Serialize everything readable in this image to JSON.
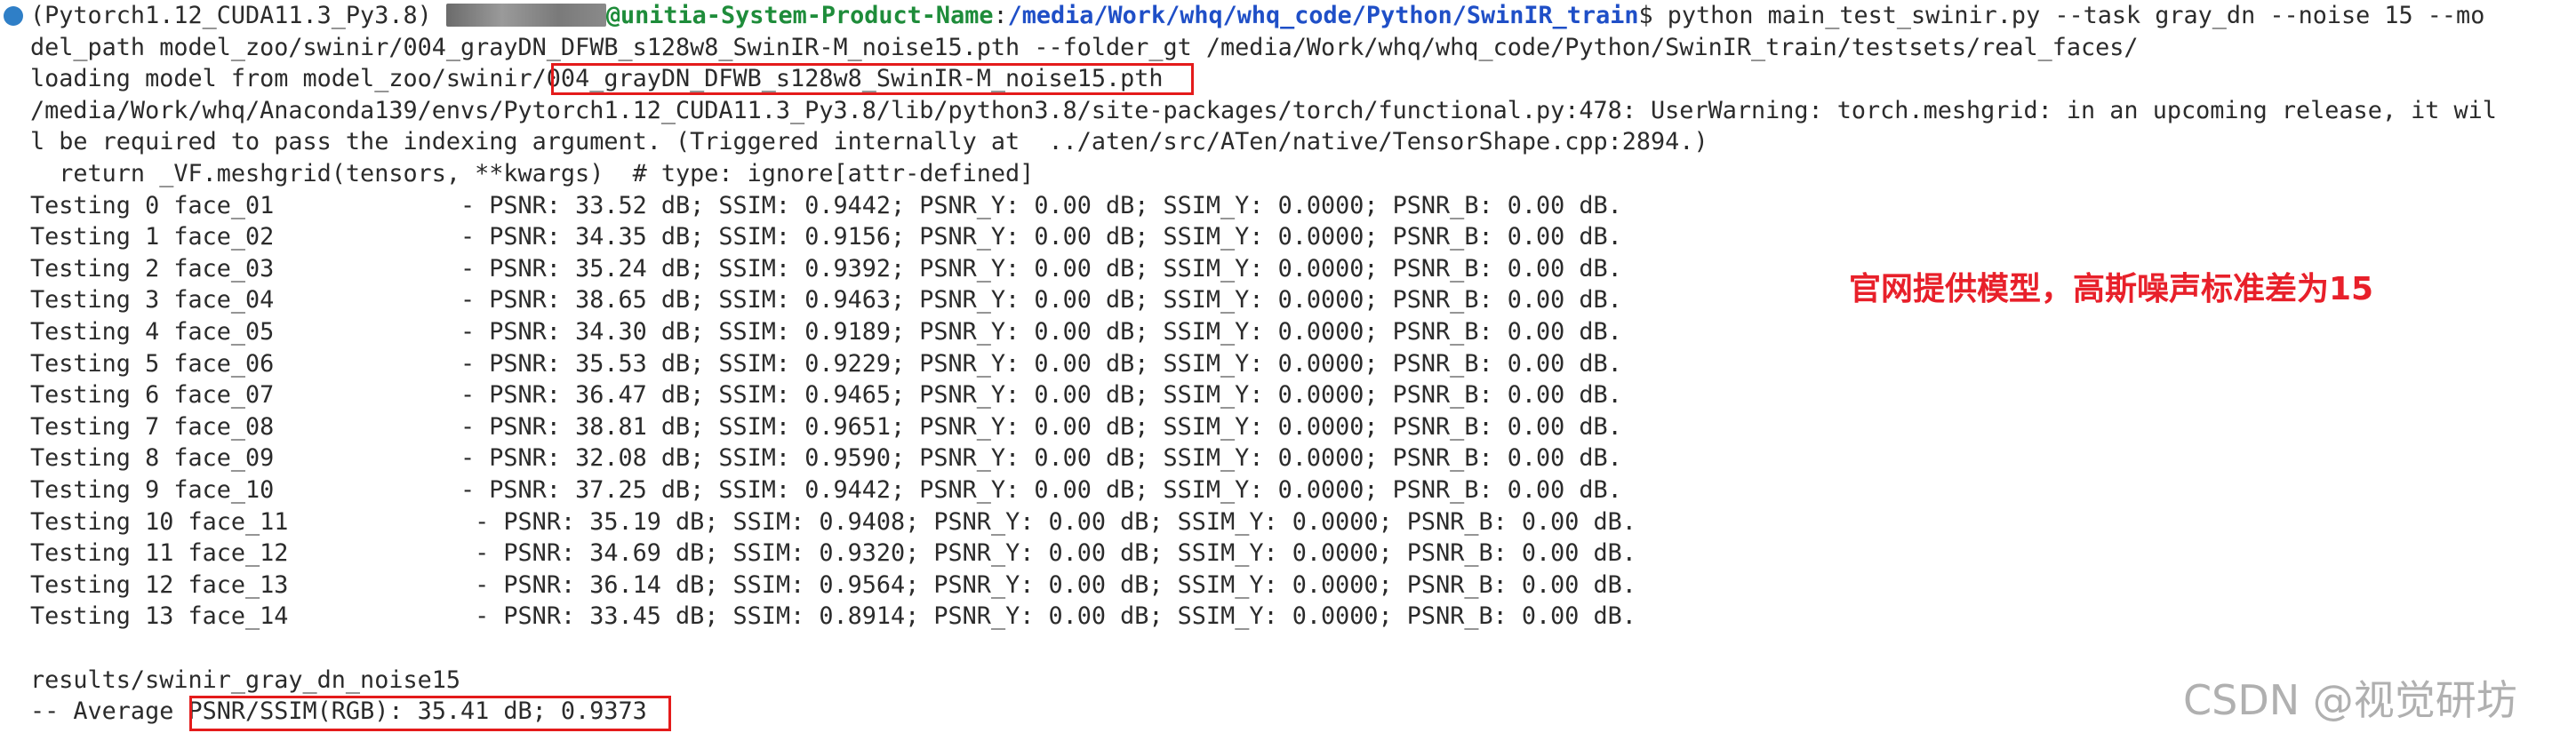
{
  "terminal": {
    "prompt_env": "(Pytorch1.12_CUDA11.3_Py3.8)",
    "prompt_host": "@unitia-System-Product-Name",
    "prompt_colon": ":",
    "prompt_path": "/media/Work/whq/whq_code/Python/SwinIR_train",
    "prompt_dollar": "$",
    "command_part1": " python main_test_swinir.py --task gray_dn --noise 15 --mo",
    "command_part2": "del_path model_zoo/swinir/004_grayDN_DFWB_s128w8_SwinIR-M_noise15.pth --folder_gt /media/Work/whq/whq_code/Python/SwinIR_train/testsets/real_faces/",
    "loading_prefix": "loading model from model_zoo/swinir/",
    "loading_file": "004_grayDN_DFWB_s128w8_SwinIR-M_noise15.pth",
    "warning_line1": "/media/Work/whq/Anaconda139/envs/Pytorch1.12_CUDA11.3_Py3.8/lib/python3.8/site-packages/torch/functional.py:478: UserWarning: torch.meshgrid: in an upcoming release, it wil",
    "warning_line2": "l be required to pass the indexing argument. (Triggered internally at  ../aten/src/ATen/native/TensorShape.cpp:2894.)",
    "warning_line3": "  return _VF.meshgrid(tensors, **kwargs)  # type: ignore[attr-defined]",
    "results": [
      {
        "label": "Testing 0 face_01",
        "pad": "             ",
        "stats": "- PSNR: 33.52 dB; SSIM: 0.9442; PSNR_Y: 0.00 dB; SSIM_Y: 0.0000; PSNR_B: 0.00 dB."
      },
      {
        "label": "Testing 1 face_02",
        "pad": "             ",
        "stats": "- PSNR: 34.35 dB; SSIM: 0.9156; PSNR_Y: 0.00 dB; SSIM_Y: 0.0000; PSNR_B: 0.00 dB."
      },
      {
        "label": "Testing 2 face_03",
        "pad": "             ",
        "stats": "- PSNR: 35.24 dB; SSIM: 0.9392; PSNR_Y: 0.00 dB; SSIM_Y: 0.0000; PSNR_B: 0.00 dB."
      },
      {
        "label": "Testing 3 face_04",
        "pad": "             ",
        "stats": "- PSNR: 38.65 dB; SSIM: 0.9463; PSNR_Y: 0.00 dB; SSIM_Y: 0.0000; PSNR_B: 0.00 dB."
      },
      {
        "label": "Testing 4 face_05",
        "pad": "             ",
        "stats": "- PSNR: 34.30 dB; SSIM: 0.9189; PSNR_Y: 0.00 dB; SSIM_Y: 0.0000; PSNR_B: 0.00 dB."
      },
      {
        "label": "Testing 5 face_06",
        "pad": "             ",
        "stats": "- PSNR: 35.53 dB; SSIM: 0.9229; PSNR_Y: 0.00 dB; SSIM_Y: 0.0000; PSNR_B: 0.00 dB."
      },
      {
        "label": "Testing 6 face_07",
        "pad": "             ",
        "stats": "- PSNR: 36.47 dB; SSIM: 0.9465; PSNR_Y: 0.00 dB; SSIM_Y: 0.0000; PSNR_B: 0.00 dB."
      },
      {
        "label": "Testing 7 face_08",
        "pad": "             ",
        "stats": "- PSNR: 38.81 dB; SSIM: 0.9651; PSNR_Y: 0.00 dB; SSIM_Y: 0.0000; PSNR_B: 0.00 dB."
      },
      {
        "label": "Testing 8 face_09",
        "pad": "             ",
        "stats": "- PSNR: 32.08 dB; SSIM: 0.9590; PSNR_Y: 0.00 dB; SSIM_Y: 0.0000; PSNR_B: 0.00 dB."
      },
      {
        "label": "Testing 9 face_10",
        "pad": "             ",
        "stats": "- PSNR: 37.25 dB; SSIM: 0.9442; PSNR_Y: 0.00 dB; SSIM_Y: 0.0000; PSNR_B: 0.00 dB."
      },
      {
        "label": "Testing 10 face_11",
        "pad": "            ",
        "stats": " - PSNR: 35.19 dB; SSIM: 0.9408; PSNR_Y: 0.00 dB; SSIM_Y: 0.0000; PSNR_B: 0.00 dB."
      },
      {
        "label": "Testing 11 face_12",
        "pad": "            ",
        "stats": " - PSNR: 34.69 dB; SSIM: 0.9320; PSNR_Y: 0.00 dB; SSIM_Y: 0.0000; PSNR_B: 0.00 dB."
      },
      {
        "label": "Testing 12 face_13",
        "pad": "            ",
        "stats": " - PSNR: 36.14 dB; SSIM: 0.9564; PSNR_Y: 0.00 dB; SSIM_Y: 0.0000; PSNR_B: 0.00 dB."
      },
      {
        "label": "Testing 13 face_14",
        "pad": "            ",
        "stats": " - PSNR: 33.45 dB; SSIM: 0.8914; PSNR_Y: 0.00 dB; SSIM_Y: 0.0000; PSNR_B: 0.00 dB."
      }
    ],
    "results_dir": "results/swinir_gray_dn_noise15",
    "average_prefix": "-- Average ",
    "average_metrics": "PSNR/SSIM(RGB): 35.41 dB; 0.9373"
  },
  "annotation": "官网提供模型，高斯噪声标准差为15",
  "watermark": "CSDN @视觉研坊",
  "colors": {
    "annotation": "#e8202a",
    "highlight_box": "#e41b1b",
    "prompt_host": "#1e8c3a",
    "prompt_path": "#1f4fc7",
    "status_dot": "#2f7fc7"
  }
}
